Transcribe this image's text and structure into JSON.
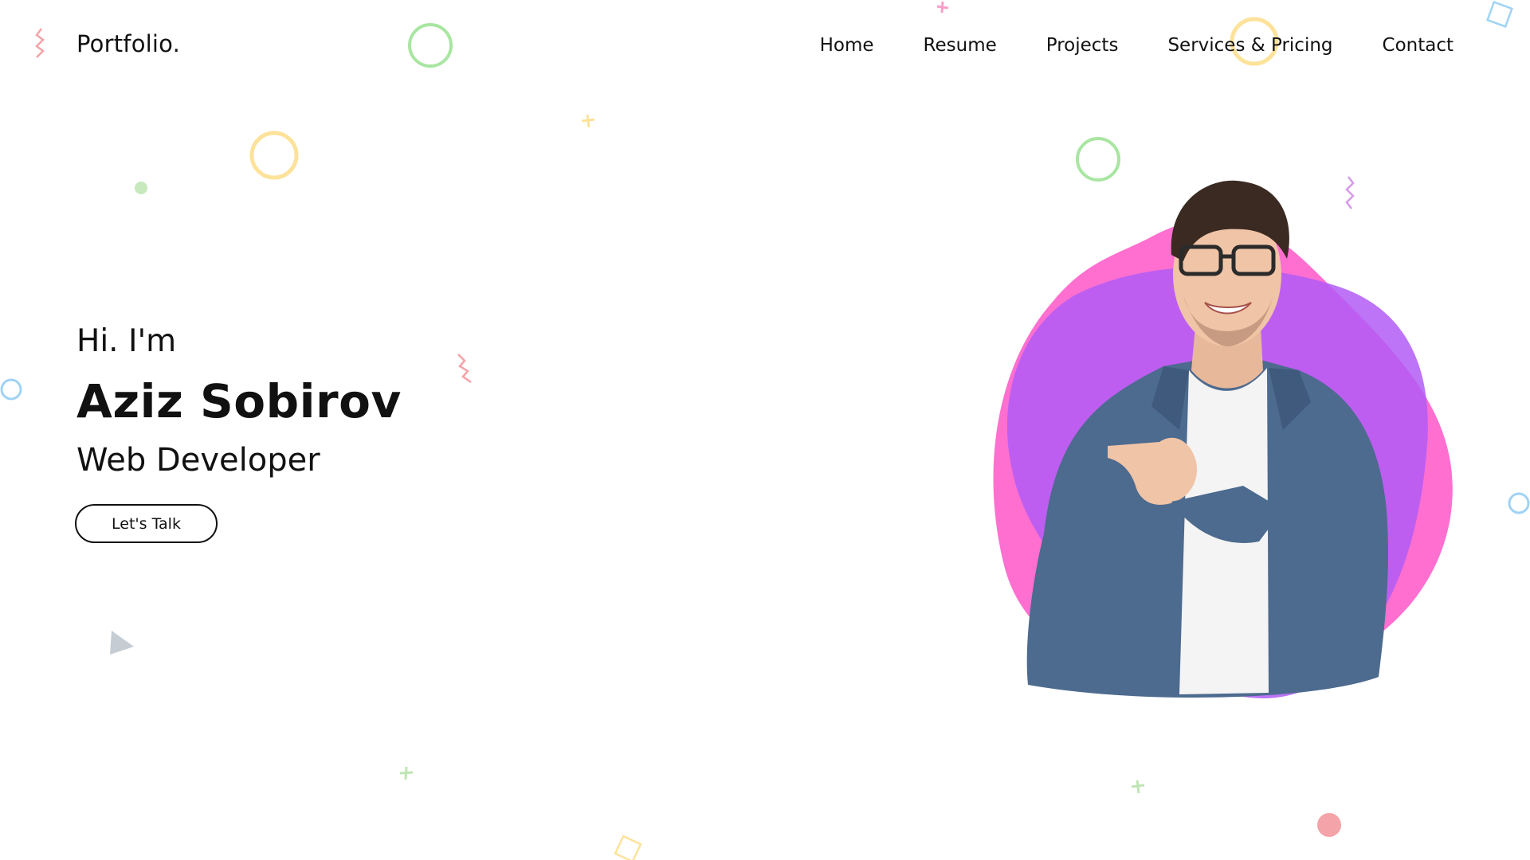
{
  "brand": {
    "name": "Portfolio."
  },
  "nav": {
    "items": [
      {
        "label": "Home"
      },
      {
        "label": "Resume"
      },
      {
        "label": "Projects"
      },
      {
        "label": "Services & Pricing"
      },
      {
        "label": "Contact"
      }
    ]
  },
  "hero": {
    "greeting": "Hi. I'm",
    "name": "Aziz Sobirov",
    "role": "Web Developer",
    "cta_label": "Let's Talk"
  },
  "colors": {
    "text": "#111111",
    "blob_pink": "#ff6fd0",
    "blob_purple": "#b25cf6",
    "blob_overlap": "#c94ee8",
    "deco_green": "#a8e6a1",
    "deco_yellow": "#fde29a",
    "deco_blue": "#9fd3f5",
    "deco_red": "#f4a3a8"
  },
  "icons": {
    "portrait": "person-photo-icon",
    "decorations": [
      "circle-outline-icon",
      "zigzag-icon",
      "plus-icon",
      "triangle-icon",
      "square-icon",
      "dot-icon"
    ]
  }
}
